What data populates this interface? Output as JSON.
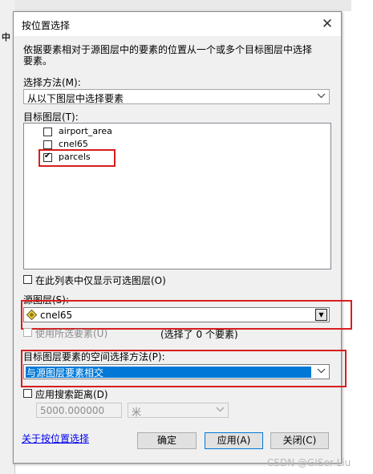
{
  "background": {
    "left_fragment": "中 ›"
  },
  "dialog": {
    "title": "按位置选择",
    "close_glyph": "✕",
    "description": "依据要素相对于源图层中的要素的位置从一个或多个目标图层中选择要素。",
    "selection_method": {
      "label": "选择方法(M):",
      "value": "从以下图层中选择要素"
    },
    "target_layers": {
      "label": "目标图层(T):",
      "items": [
        {
          "name": "airport_area",
          "checked": false
        },
        {
          "name": "cnel65",
          "checked": false
        },
        {
          "name": "parcels",
          "checked": true
        }
      ]
    },
    "only_selectable_checkbox": {
      "label": "在此列表中仅显示可选图层(O)",
      "checked": false
    },
    "source_layer": {
      "label": "源图层(S):",
      "value": "cnel65"
    },
    "use_selected_features": {
      "label": "使用所选要素(U)",
      "checked": false,
      "status": "(选择了 0 个要素)"
    },
    "spatial_method": {
      "label": "目标图层要素的空间选择方法(P):",
      "value": "与源图层要素相交"
    },
    "search_distance": {
      "label": "应用搜索距离(D)",
      "checked": false,
      "value": "5000.000000",
      "unit": "米"
    },
    "help_link": "关于按位置选择",
    "buttons": {
      "ok": "确定",
      "apply": "应用(A)",
      "close": "关闭(C)"
    }
  },
  "watermark": "CSDN @GISer Liu",
  "colors": {
    "highlight_border": "#d81e1e",
    "selection_blue": "#0078d7",
    "dialog_bg": "#f0f0f0"
  }
}
